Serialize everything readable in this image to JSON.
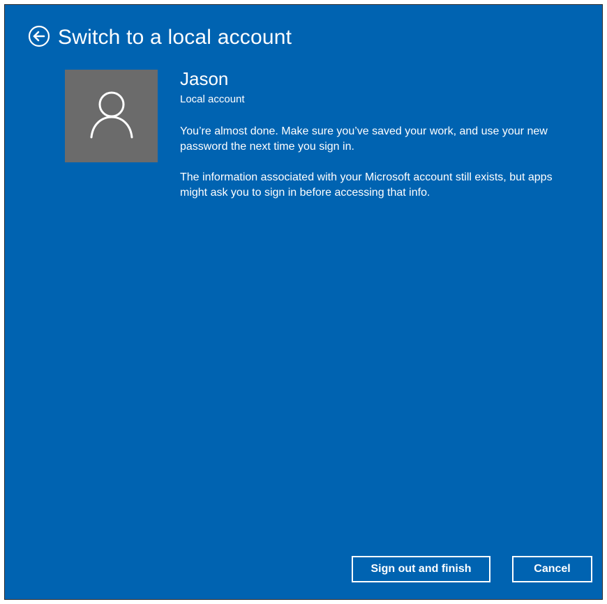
{
  "header": {
    "back_icon": "back-arrow-circle-icon",
    "title": "Switch to a local account"
  },
  "user": {
    "avatar_icon": "user-silhouette-icon",
    "name": "Jason",
    "account_type": "Local account"
  },
  "messages": {
    "line1": "You’re almost done. Make sure you’ve saved your work, and use your new password the next time you sign in.",
    "line2": "The information associated with your Microsoft account still exists, but apps might ask you to sign in before accessing that info."
  },
  "buttons": {
    "primary_label": "Sign out and finish",
    "cancel_label": "Cancel"
  },
  "colors": {
    "background": "#0063b1",
    "avatar_background": "#6b6b6b",
    "text": "#ffffff"
  }
}
